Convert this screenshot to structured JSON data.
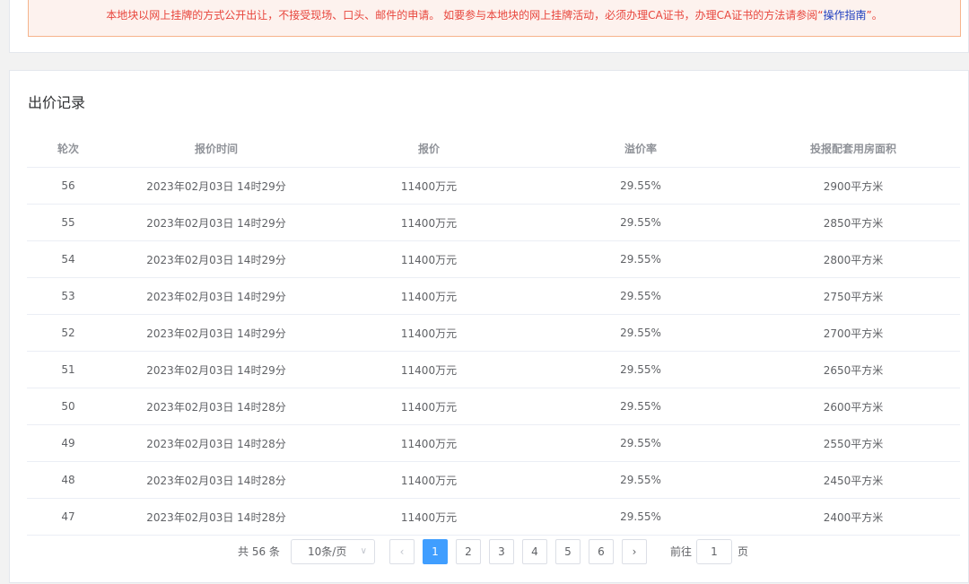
{
  "notice": {
    "text": "本地块以网上挂牌的方式公开出让，不接受现场、口头、邮件的申请。 如要参与本地块的网上挂牌活动，必须办理CA证书，办理CA证书的方法请参阅“",
    "link_label": "操作指南",
    "suffix": "”。"
  },
  "section": {
    "title": "出价记录"
  },
  "table": {
    "headers": [
      "轮次",
      "报价时间",
      "报价",
      "溢价率",
      "投报配套用房面积"
    ],
    "rows": [
      [
        "56",
        "2023年02月03日 14时29分",
        "11400万元",
        "29.55%",
        "2900平方米"
      ],
      [
        "55",
        "2023年02月03日 14时29分",
        "11400万元",
        "29.55%",
        "2850平方米"
      ],
      [
        "54",
        "2023年02月03日 14时29分",
        "11400万元",
        "29.55%",
        "2800平方米"
      ],
      [
        "53",
        "2023年02月03日 14时29分",
        "11400万元",
        "29.55%",
        "2750平方米"
      ],
      [
        "52",
        "2023年02月03日 14时29分",
        "11400万元",
        "29.55%",
        "2700平方米"
      ],
      [
        "51",
        "2023年02月03日 14时29分",
        "11400万元",
        "29.55%",
        "2650平方米"
      ],
      [
        "50",
        "2023年02月03日 14时28分",
        "11400万元",
        "29.55%",
        "2600平方米"
      ],
      [
        "49",
        "2023年02月03日 14时28分",
        "11400万元",
        "29.55%",
        "2550平方米"
      ],
      [
        "48",
        "2023年02月03日 14时28分",
        "11400万元",
        "29.55%",
        "2450平方米"
      ],
      [
        "47",
        "2023年02月03日 14时28分",
        "11400万元",
        "29.55%",
        "2400平方米"
      ]
    ]
  },
  "pagination": {
    "total_label": "共 56 条",
    "page_size": "10条/页",
    "prev_icon": "‹",
    "next_icon": "›",
    "pages": [
      "1",
      "2",
      "3",
      "4",
      "5",
      "6"
    ],
    "current_page": "1",
    "goto_label": "前往",
    "goto_value": "1",
    "page_unit": "页"
  },
  "colors": {
    "notice_text": "#e8453c",
    "notice_border": "#f6b48c",
    "link": "#1f3fbf",
    "active_page": "#409eff"
  }
}
